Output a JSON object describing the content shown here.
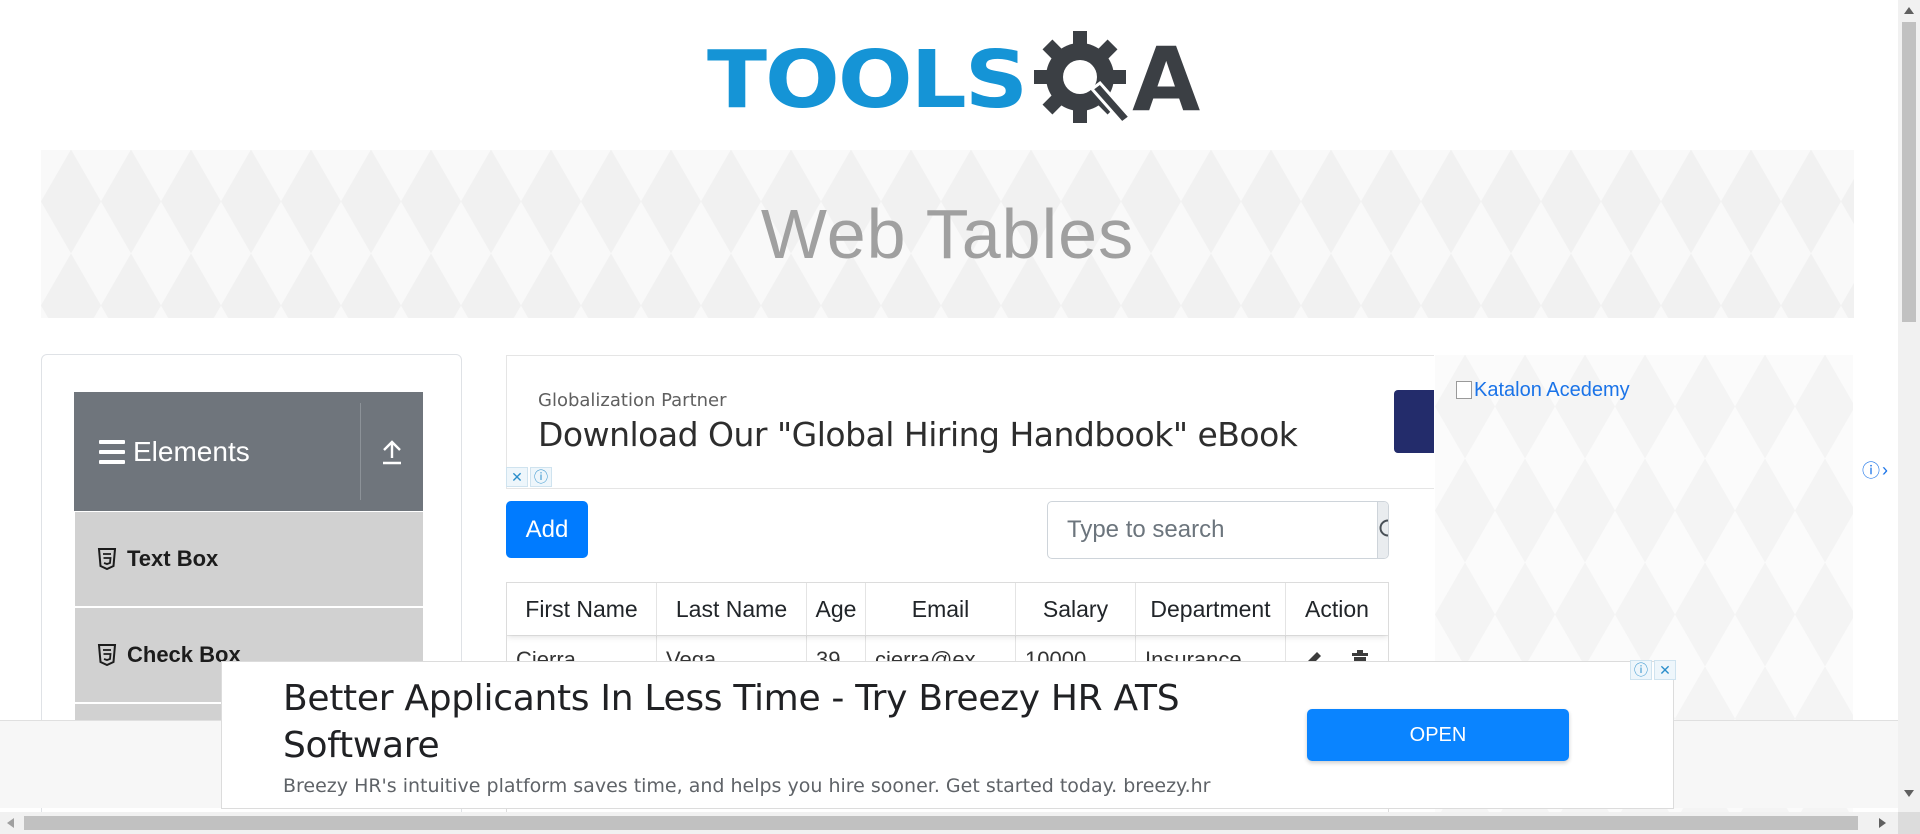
{
  "logo": {
    "text_left": "TOOLS",
    "text_right": "A",
    "colors": {
      "blue": "#1594d6",
      "dark": "#3b3f44"
    }
  },
  "banner": {
    "title": "Web Tables"
  },
  "sidebar": {
    "group_title": "Elements",
    "items": [
      {
        "label": "Text Box",
        "icon": "html5-icon"
      },
      {
        "label": "Check Box",
        "icon": "html5-icon"
      }
    ]
  },
  "top_ad": {
    "label": "Globalization Partner",
    "headline": "Download Our \"Global Hiring Handbook\" eBook"
  },
  "toolbar": {
    "add_label": "Add",
    "search_placeholder": "Type to search"
  },
  "table": {
    "columns": [
      "First Name",
      "Last Name",
      "Age",
      "Email",
      "Salary",
      "Department",
      "Action"
    ],
    "rows": [
      {
        "first_name": "Cierra",
        "last_name": "Vega",
        "age": "39",
        "email": "cierra@ex",
        "salary": "10000",
        "department": "Insurance"
      }
    ]
  },
  "right_ad": {
    "image_alt": "Katalon Acedemy"
  },
  "bottom_ad": {
    "headline": "Better Applicants In Less Time - Try Breezy HR ATS Software",
    "description": "Breezy HR's intuitive platform saves time, and helps you hire sooner. Get started today. breezy.hr",
    "cta_label": "OPEN"
  },
  "colors": {
    "primary": "#007bff",
    "sidebar_header": "#6f757c",
    "menu_item": "#d1d1d1"
  }
}
